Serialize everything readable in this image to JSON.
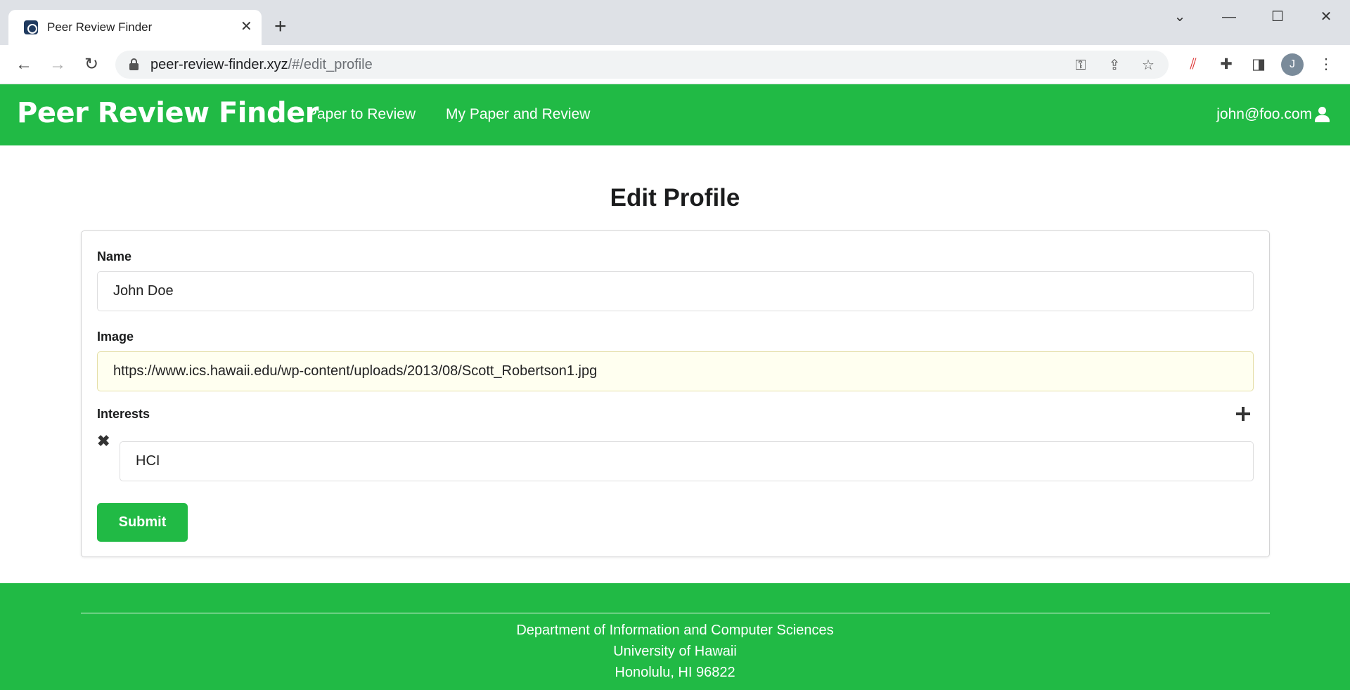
{
  "browser": {
    "tab_title": "Peer Review Finder",
    "url_domain": "peer-review-finder.xyz",
    "url_path": "/#/edit_profile",
    "profile_initial": "J"
  },
  "navbar": {
    "brand": "Peer Review Finder",
    "links": [
      "Paper to Review",
      "My Paper and Review"
    ],
    "user_email": "john@foo.com",
    "background_color": "#21ba45"
  },
  "page": {
    "title": "Edit Profile"
  },
  "form": {
    "name_label": "Name",
    "name_value": "John Doe",
    "image_label": "Image",
    "image_value": "https://www.ics.hawaii.edu/wp-content/uploads/2013/08/Scott_Robertson1.jpg",
    "interests_label": "Interests",
    "interests": [
      "HCI"
    ],
    "submit_label": "Submit"
  },
  "footer": {
    "lines": [
      "Department of Information and Computer Sciences",
      "University of Hawaii",
      "Honolulu, HI 96822"
    ]
  }
}
